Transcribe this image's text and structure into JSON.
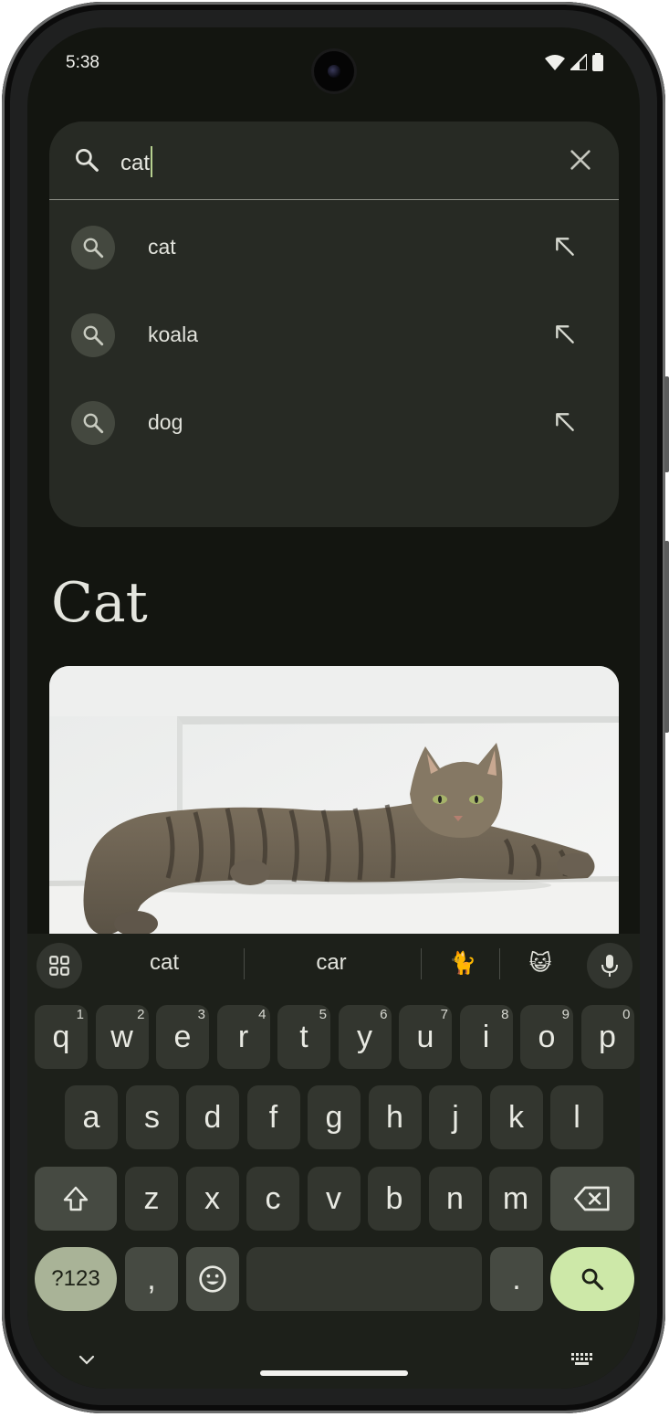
{
  "status": {
    "time": "5:38"
  },
  "search": {
    "query": "cat"
  },
  "suggestions": [
    {
      "label": "cat"
    },
    {
      "label": "koala"
    },
    {
      "label": "dog"
    }
  ],
  "result": {
    "title": "Cat"
  },
  "keyboard": {
    "suggestions": [
      "cat",
      "car",
      "🐈",
      "😺"
    ],
    "row1": [
      {
        "k": "q",
        "n": "1"
      },
      {
        "k": "w",
        "n": "2"
      },
      {
        "k": "e",
        "n": "3"
      },
      {
        "k": "r",
        "n": "4"
      },
      {
        "k": "t",
        "n": "5"
      },
      {
        "k": "y",
        "n": "6"
      },
      {
        "k": "u",
        "n": "7"
      },
      {
        "k": "i",
        "n": "8"
      },
      {
        "k": "o",
        "n": "9"
      },
      {
        "k": "p",
        "n": "0"
      }
    ],
    "row2": [
      "a",
      "s",
      "d",
      "f",
      "g",
      "h",
      "j",
      "k",
      "l"
    ],
    "row3": [
      "z",
      "x",
      "c",
      "v",
      "b",
      "n",
      "m"
    ],
    "symbols_label": "?123",
    "comma": ",",
    "period": "."
  },
  "colors": {
    "background": "#131510",
    "card": "#272a24",
    "accent": "#cde8a8",
    "caret": "#b6d08f"
  },
  "icons": [
    "search-icon",
    "close-icon",
    "north-west-arrow-icon",
    "apps-grid-icon",
    "mic-icon",
    "shift-icon",
    "backspace-icon",
    "emoji-icon",
    "chevron-down-icon",
    "keyboard-icon",
    "wifi-icon",
    "cellular-icon",
    "battery-icon"
  ]
}
